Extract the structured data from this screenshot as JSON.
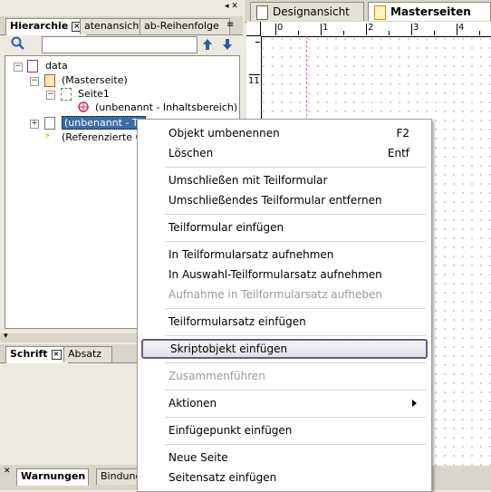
{
  "left_panel": {
    "tabs": [
      {
        "label": "Hierarchie"
      },
      {
        "label": "atenansicht"
      },
      {
        "label": "ab-Reihenfolge"
      }
    ],
    "tree": [
      {
        "label": "data"
      },
      {
        "label": "(Masterseite)"
      },
      {
        "label": "Seite1"
      },
      {
        "label": "(unbenannt - Inhaltsbereich)"
      },
      {
        "label": "(unbenannt - Te"
      },
      {
        "label": "(Referenzierte O"
      }
    ],
    "bottom_tabs": [
      {
        "label": "Schrift"
      },
      {
        "label": "Absatz"
      }
    ],
    "footer_tabs": [
      {
        "label": "Warnungen"
      },
      {
        "label": "Bindung"
      }
    ]
  },
  "doc_tabs": [
    {
      "label": "Designansicht"
    },
    {
      "label": "Masterseiten"
    }
  ],
  "ruler": {
    "h_labels": [
      "0",
      "1",
      "2",
      "3",
      "4"
    ],
    "v_label": "11"
  },
  "context_menu": {
    "items": [
      {
        "label": "Objekt umbenennen",
        "shortcut": "F2"
      },
      {
        "label": "Löschen",
        "shortcut": "Entf"
      },
      {
        "label": "Umschließen mit Teilformular"
      },
      {
        "label": "Umschließendes Teilformular entfernen"
      },
      {
        "label": "Teilformular einfügen"
      },
      {
        "label": "In Teilformularsatz aufnehmen"
      },
      {
        "label": "In Auswahl-Teilformularsatz aufnehmen"
      },
      {
        "label": "Aufnahme in Teilformularsatz aufheben"
      },
      {
        "label": "Teilformularsatz einfügen"
      },
      {
        "label": "Skriptobjekt einfügen"
      },
      {
        "label": "Zusammenführen"
      },
      {
        "label": "Aktionen"
      },
      {
        "label": "Einfügepunkt einfügen"
      },
      {
        "label": "Neue Seite"
      },
      {
        "label": "Seitensatz einfügen"
      }
    ]
  },
  "colors": {
    "selection": "#3a6ea5",
    "menu_hover_border": "#6c5a85"
  }
}
